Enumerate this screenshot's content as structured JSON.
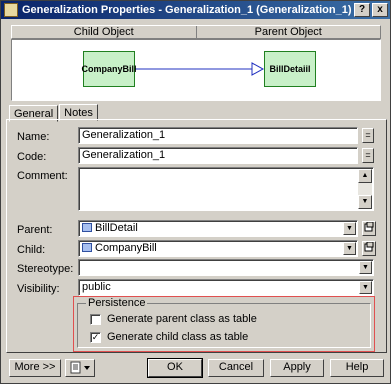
{
  "window": {
    "title": "Generalization Properties - Generalization_1 (Generalization_1)",
    "help_btn": "?",
    "close_btn": "x"
  },
  "diagram": {
    "child_header": "Child Object",
    "parent_header": "Parent Object",
    "child_node": "CompanyBill",
    "parent_node": "BillDetaiil"
  },
  "tabs": [
    {
      "label": "General",
      "active": true
    },
    {
      "label": "Notes",
      "active": false
    }
  ],
  "form": {
    "name_label": "Name:",
    "name_value": "Generalization_1",
    "name_btn": "=",
    "code_label": "Code:",
    "code_value": "Generalization_1",
    "code_btn": "=",
    "comment_label": "Comment:",
    "comment_value": "",
    "parent_label": "Parent:",
    "parent_value": "BillDetail",
    "child_label": "Child:",
    "child_value": "CompanyBill",
    "stereotype_label": "Stereotype:",
    "stereotype_value": "",
    "visibility_label": "Visibility:",
    "visibility_value": "public"
  },
  "persistence": {
    "title": "Persistence",
    "parent_checkbox": {
      "label": "Generate parent class as table",
      "checked": false
    },
    "child_checkbox": {
      "label": "Generate child class as table",
      "checked": true
    }
  },
  "buttons": {
    "more": "More >>",
    "ok": "OK",
    "cancel": "Cancel",
    "apply": "Apply",
    "help": "Help"
  },
  "glyphs": {
    "combo_arrow": "▼",
    "scroll_up": "▲",
    "scroll_down": "▼",
    "check": "✓",
    "dropdown": "▾"
  }
}
